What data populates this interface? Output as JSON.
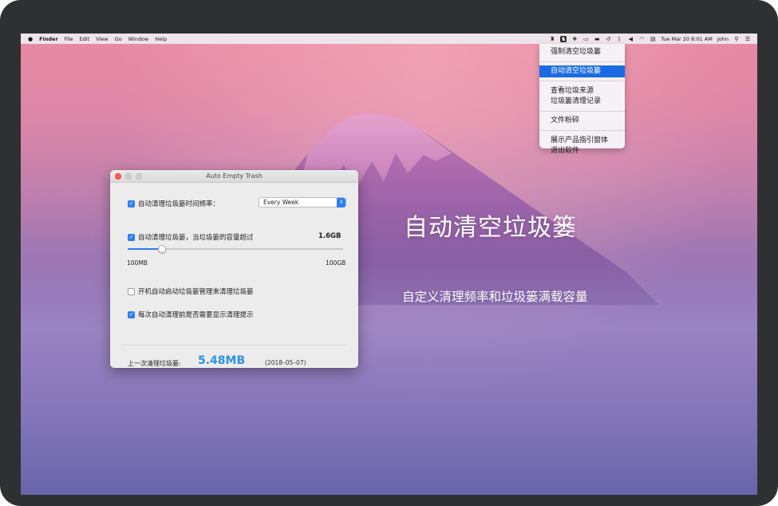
{
  "menubar": {
    "app_name": "Finder",
    "menus": [
      "File",
      "Edit",
      "View",
      "Go",
      "Window",
      "Help"
    ],
    "clock": "Tue Mar 20  8:01 AM",
    "user": "John"
  },
  "status_menu": {
    "items": [
      {
        "label": "强制清空垃圾篓"
      },
      {
        "label": "自动清空垃圾篓",
        "selected": true
      },
      {
        "label": "查看垃圾来源"
      },
      {
        "label": "垃圾篓清理记录"
      },
      {
        "label": "文件粉碎"
      },
      {
        "label": "展示产品指引窗体"
      },
      {
        "label": "退出软件"
      }
    ]
  },
  "window": {
    "title": "Auto Empty Trash",
    "frequency": {
      "checked": true,
      "label": "自动清理垃圾篓时间频率：",
      "selected_option": "Every Week"
    },
    "capacity": {
      "checked": true,
      "label": "自动清理垃圾篓，当垃圾篓的容量超过",
      "value_label": "1.6GB",
      "slider_min_label": "100MB",
      "slider_max_label": "100GB",
      "slider_fraction": 0.16
    },
    "launch_at_login": {
      "checked": false,
      "label": "开机自动启动垃圾篓管理来清理垃圾篓"
    },
    "show_prompt": {
      "checked": true,
      "label": "每次自动清理前是否需要显示清理提示"
    },
    "last_clean": {
      "label": "上一次清理垃圾篓:",
      "size": "5.48MB",
      "date": "(2018–05–07)"
    }
  },
  "hero": {
    "title": "自动清空垃圾篓",
    "subtitle": "自定义清理频率和垃圾篓满载容量"
  },
  "colors": {
    "accent": "#2d7ff0",
    "size_highlight": "#2d92e6",
    "menu_selection": "#1a6be3"
  }
}
